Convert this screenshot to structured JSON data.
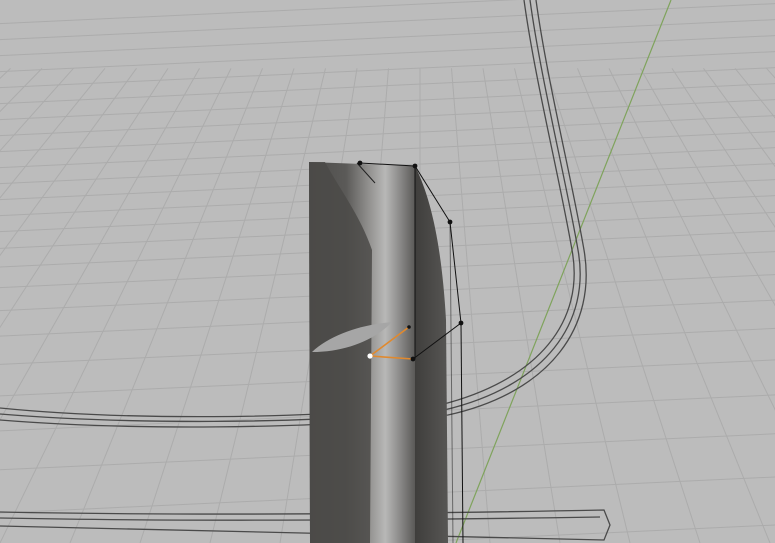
{
  "app": {
    "view": "3D Viewport"
  },
  "scene": {
    "background": "#bcbcbc",
    "grid_line_color": "#acacac",
    "y_axis_color": "#7fa35c",
    "reference_outline_color": "#4a4a4a",
    "mesh_dark_color": "#4f4e4c",
    "mesh_mid_color": "#7c7b79",
    "mesh_highlight_color": "#b9b9b8",
    "wire_color": "#111111",
    "selected_edge_color": "#e0892e",
    "active_vertex_color": "#ffffff"
  },
  "mesh": {
    "selected_vertex_count": 1,
    "visible_vertex_count": 7
  }
}
